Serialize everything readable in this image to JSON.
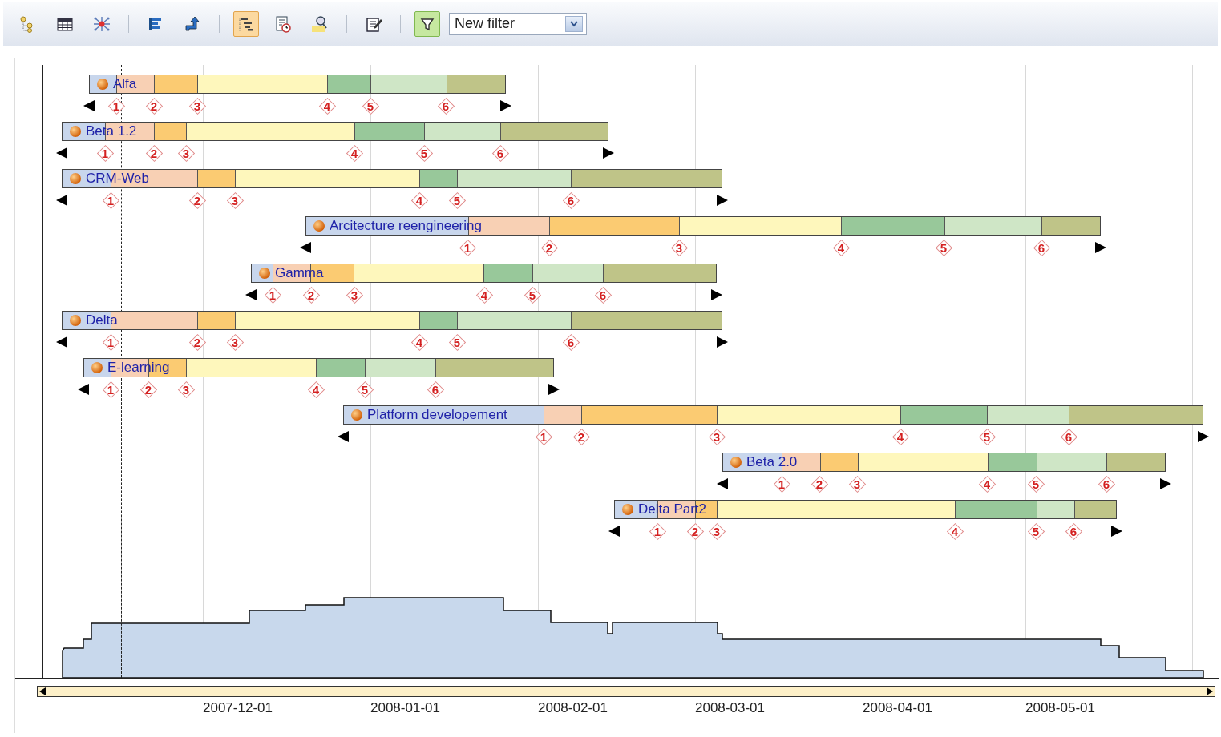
{
  "toolbar": {
    "buttons": [
      {
        "selected": false
      },
      {
        "selected": false
      },
      {
        "selected": false
      },
      {
        "selected": false
      },
      {
        "selected": false
      },
      {
        "selected": true
      },
      {
        "selected": false
      },
      {
        "selected": false
      },
      {
        "selected": false
      },
      {
        "selected": true
      }
    ],
    "filter": {
      "value": "New filter"
    }
  },
  "gantt": {
    "projects": [
      {
        "name": "Alfa",
        "milestones": [
          "1",
          "2",
          "3",
          "4",
          "5",
          "6"
        ]
      },
      {
        "name": "Beta 1.2",
        "milestones": [
          "1",
          "2",
          "3",
          "4",
          "5",
          "6"
        ]
      },
      {
        "name": "CRM-Web",
        "milestones": [
          "1",
          "2",
          "3",
          "4",
          "5",
          "6"
        ]
      },
      {
        "name": "Arcitecture reengineering",
        "milestones": [
          "1",
          "2",
          "3",
          "4",
          "5",
          "6"
        ]
      },
      {
        "name": "Gamma",
        "milestones": [
          "1",
          "2",
          "3",
          "4",
          "5",
          "6"
        ]
      },
      {
        "name": "Delta",
        "milestones": [
          "1",
          "2",
          "3",
          "4",
          "5",
          "6"
        ]
      },
      {
        "name": "E-learning",
        "milestones": [
          "1",
          "2",
          "3",
          "4",
          "5",
          "6"
        ]
      },
      {
        "name": "Platform developement",
        "milestones": [
          "1",
          "2",
          "3",
          "4",
          "5",
          "6"
        ]
      },
      {
        "name": "Beta 2.0",
        "milestones": [
          "1",
          "2",
          "3",
          "4",
          "5",
          "6"
        ]
      },
      {
        "name": "Delta Part2",
        "milestones": [
          "1",
          "2",
          "3",
          "4",
          "5",
          "6"
        ]
      }
    ],
    "axis_labels": [
      "2007-12-01",
      "2008-01-01",
      "2008-02-01",
      "2008-03-01",
      "2008-04-01",
      "2008-05-01"
    ]
  }
}
